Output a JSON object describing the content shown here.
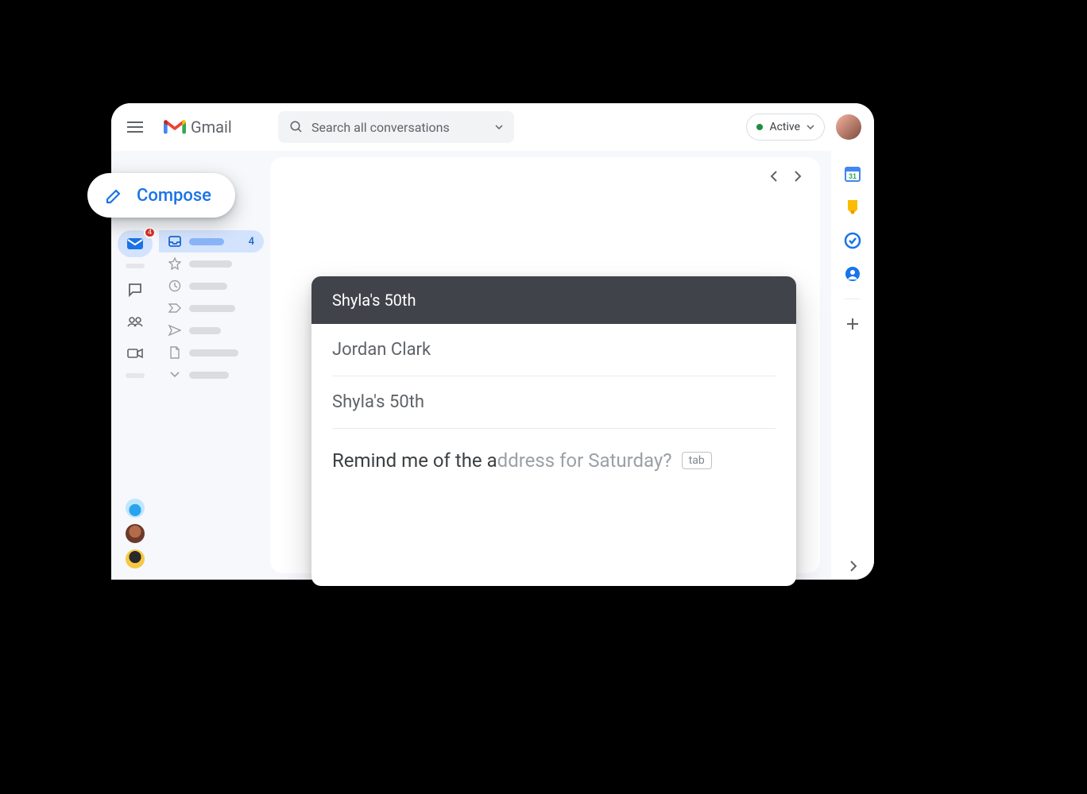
{
  "header": {
    "app_name": "Gmail",
    "search_placeholder": "Search all conversations",
    "status_label": "Active"
  },
  "rail": {
    "mail_badge": "4"
  },
  "nav": {
    "selected_count": "4"
  },
  "compose_button": {
    "label": "Compose"
  },
  "compose": {
    "title": "Shyla's 50th",
    "to": "Jordan Clark",
    "subject": "Shyla's 50th",
    "typed_text": "Remind me of the a",
    "suggestion_text": "ddress for Saturday?",
    "tab_hint": "tab"
  }
}
